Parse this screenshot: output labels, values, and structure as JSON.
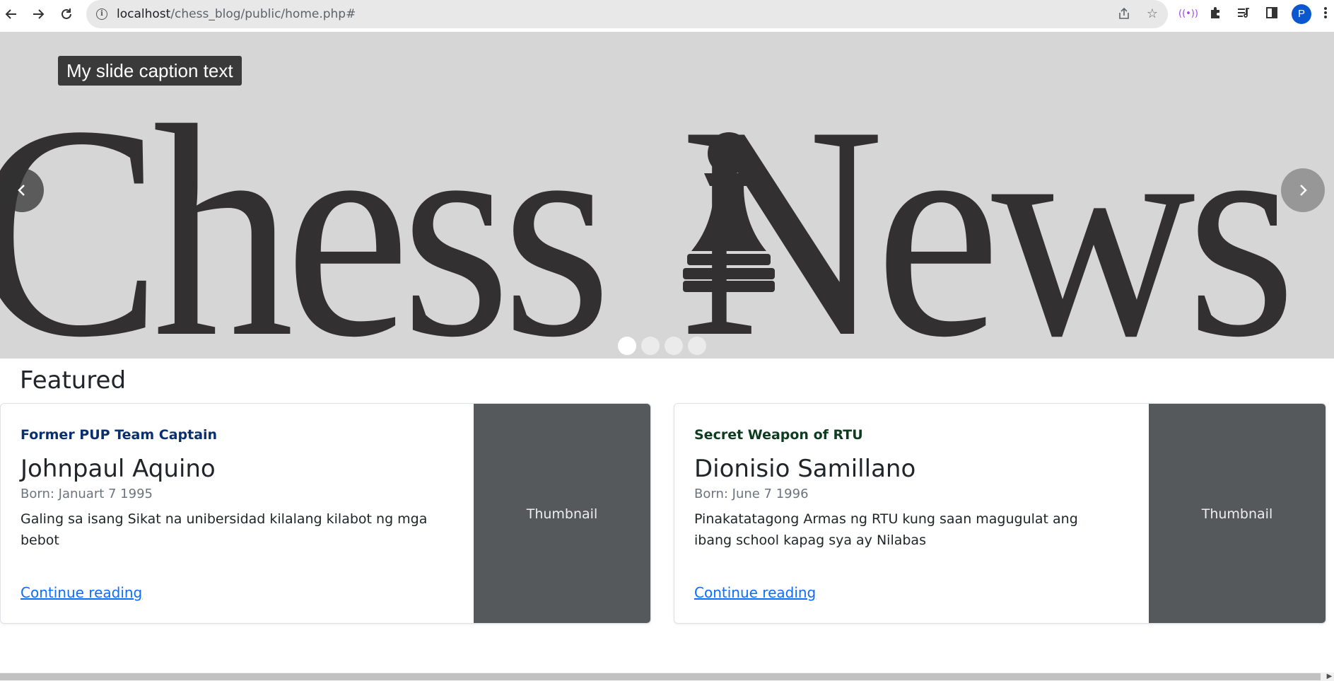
{
  "browser": {
    "url_host": "localhost",
    "url_path": "/chess_blog/public/home.php#",
    "profile_initial": "P",
    "icons": [
      "back-arrow-icon",
      "forward-arrow-icon",
      "reload-icon",
      "info-icon",
      "share-icon",
      "star-icon",
      "cast-icon",
      "extensions-icon",
      "reading-list-icon",
      "side-panel-icon",
      "more-menu-icon"
    ]
  },
  "carousel": {
    "caption": "My slide caption text",
    "hero_part1": "Chess",
    "hero_part2": "News",
    "slides_count": 4,
    "active_slide": 1,
    "colors": {
      "background": "#d6d6d6",
      "logo": "#333031"
    }
  },
  "featured": {
    "title": "Featured",
    "cards": [
      {
        "kicker": "Former PUP Team Captain",
        "kicker_color": "#0a2f6e",
        "name": "Johnpaul Aquino",
        "born": "Born: Januart 7 1995",
        "description": "Galing sa isang Sikat na unibersidad kilalang kilabot ng mga bebot",
        "link": "Continue reading",
        "thumbnail": "Thumbnail"
      },
      {
        "kicker": "Secret Weapon of RTU",
        "kicker_color": "#0f3b1f",
        "name": "Dionisio Samillano",
        "born": "Born: June 7 1996",
        "description": "Pinakatatagong Armas ng RTU kung saan magugulat ang ibang school kapag sya ay Nilabas",
        "link": "Continue reading",
        "thumbnail": "Thumbnail"
      }
    ]
  }
}
